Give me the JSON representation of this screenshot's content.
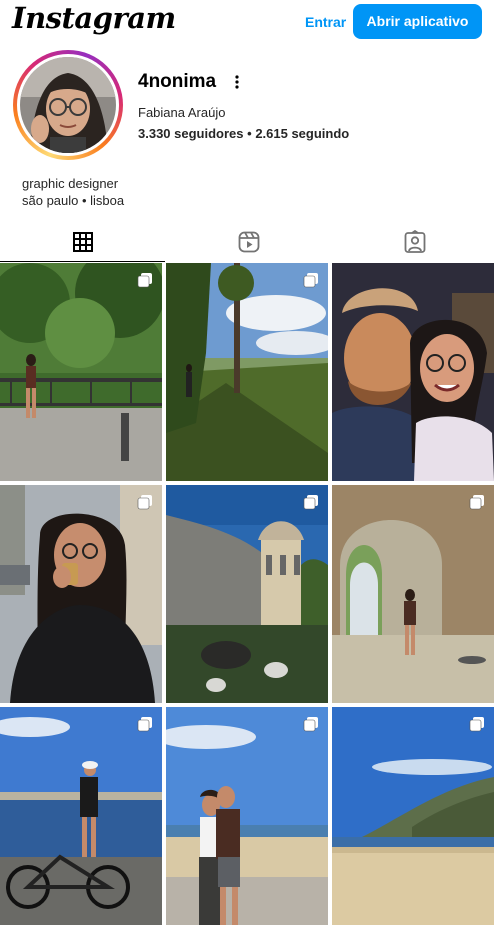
{
  "header": {
    "logo_text": "Instagram",
    "login_label": "Entrar",
    "open_app_label": "Abrir aplicativo"
  },
  "profile": {
    "username": "4nonima",
    "full_name": "Fabiana Araújo",
    "followers": "3.330 seguidores",
    "separator": "•",
    "following": "2.615 seguindo",
    "bio_line1": "graphic designer",
    "bio_line2": "são paulo • lisboa"
  },
  "tabs": [
    {
      "icon": "grid-icon",
      "active": true
    },
    {
      "icon": "reels-icon",
      "active": false
    },
    {
      "icon": "tagged-icon",
      "active": false
    }
  ],
  "posts": [
    {
      "scene": "woman standing on bridge with railing, trees",
      "multi": true
    },
    {
      "scene": "person on hillside path, valley view",
      "multi": true
    },
    {
      "scene": "illustrated couple selfie at night",
      "multi": false
    },
    {
      "scene": "woman drinking coffee on street",
      "multi": true
    },
    {
      "scene": "historic colonnade building courtyard",
      "multi": true
    },
    {
      "scene": "woman under stone archway",
      "multi": true
    },
    {
      "scene": "woman with bicycle by the sea",
      "multi": true
    },
    {
      "scene": "couple on beach promenade",
      "multi": true
    },
    {
      "scene": "beach with cliffs",
      "multi": true
    }
  ],
  "colors": {
    "accent": "#0095f6",
    "text": "#262626"
  }
}
